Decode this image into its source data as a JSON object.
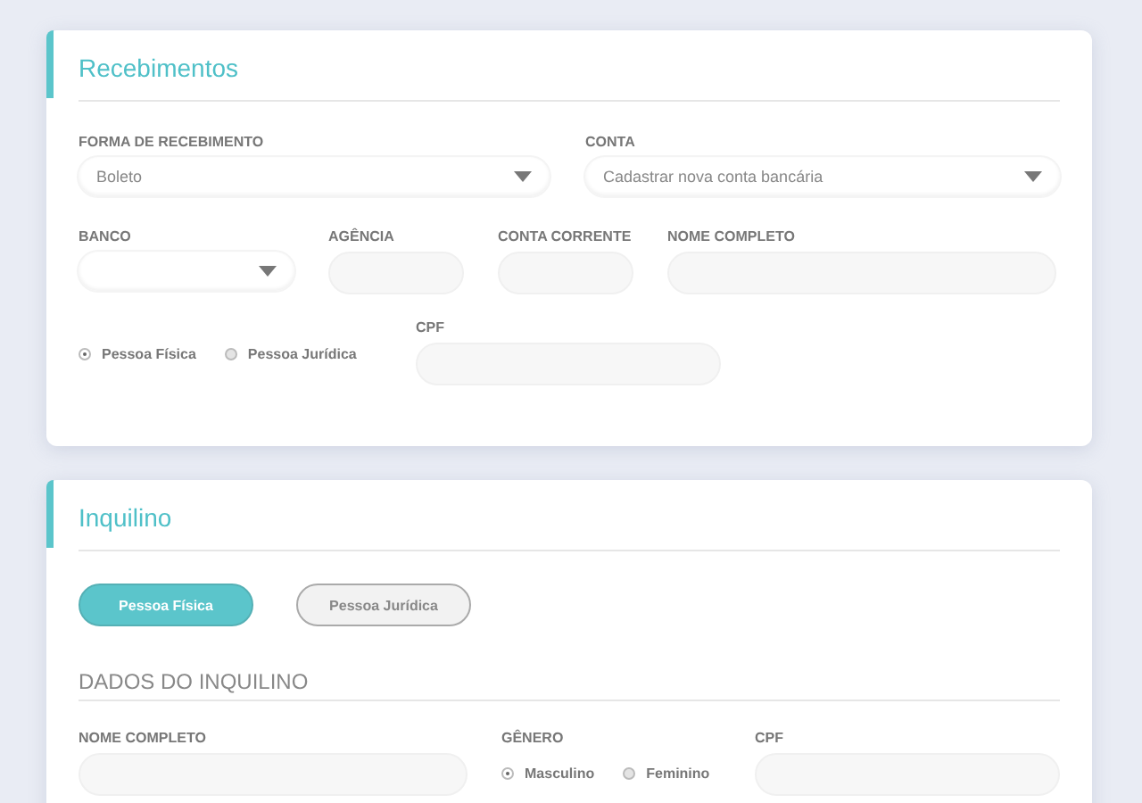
{
  "recebimentos": {
    "title": "Recebimentos",
    "forma": {
      "label": "FORMA DE RECEBIMENTO",
      "value": "Boleto"
    },
    "conta": {
      "label": "CONTA",
      "value": "Cadastrar nova conta bancária"
    },
    "banco": {
      "label": "BANCO"
    },
    "agencia": {
      "label": "AGÊNCIA"
    },
    "conta_corrente": {
      "label": "CONTA CORRENTE"
    },
    "nome": {
      "label": "NOME COMPLETO"
    },
    "tipo": [
      {
        "label": "Pessoa Física",
        "selected": true
      },
      {
        "label": "Pessoa Jurídica",
        "selected": false
      }
    ],
    "cpf": {
      "label": "CPF"
    }
  },
  "inquilino": {
    "title": "Inquilino",
    "tipo_buttons": [
      {
        "label": "Pessoa Física",
        "selected": true
      },
      {
        "label": "Pessoa Jurídica",
        "selected": false
      }
    ],
    "section_title": "DADOS DO INQUILINO",
    "nome": {
      "label": "NOME COMPLETO"
    },
    "genero": {
      "label": "GÊNERO",
      "options": [
        {
          "label": "Masculino",
          "selected": true
        },
        {
          "label": "Feminino",
          "selected": false
        }
      ]
    },
    "cpf": {
      "label": "CPF"
    }
  }
}
